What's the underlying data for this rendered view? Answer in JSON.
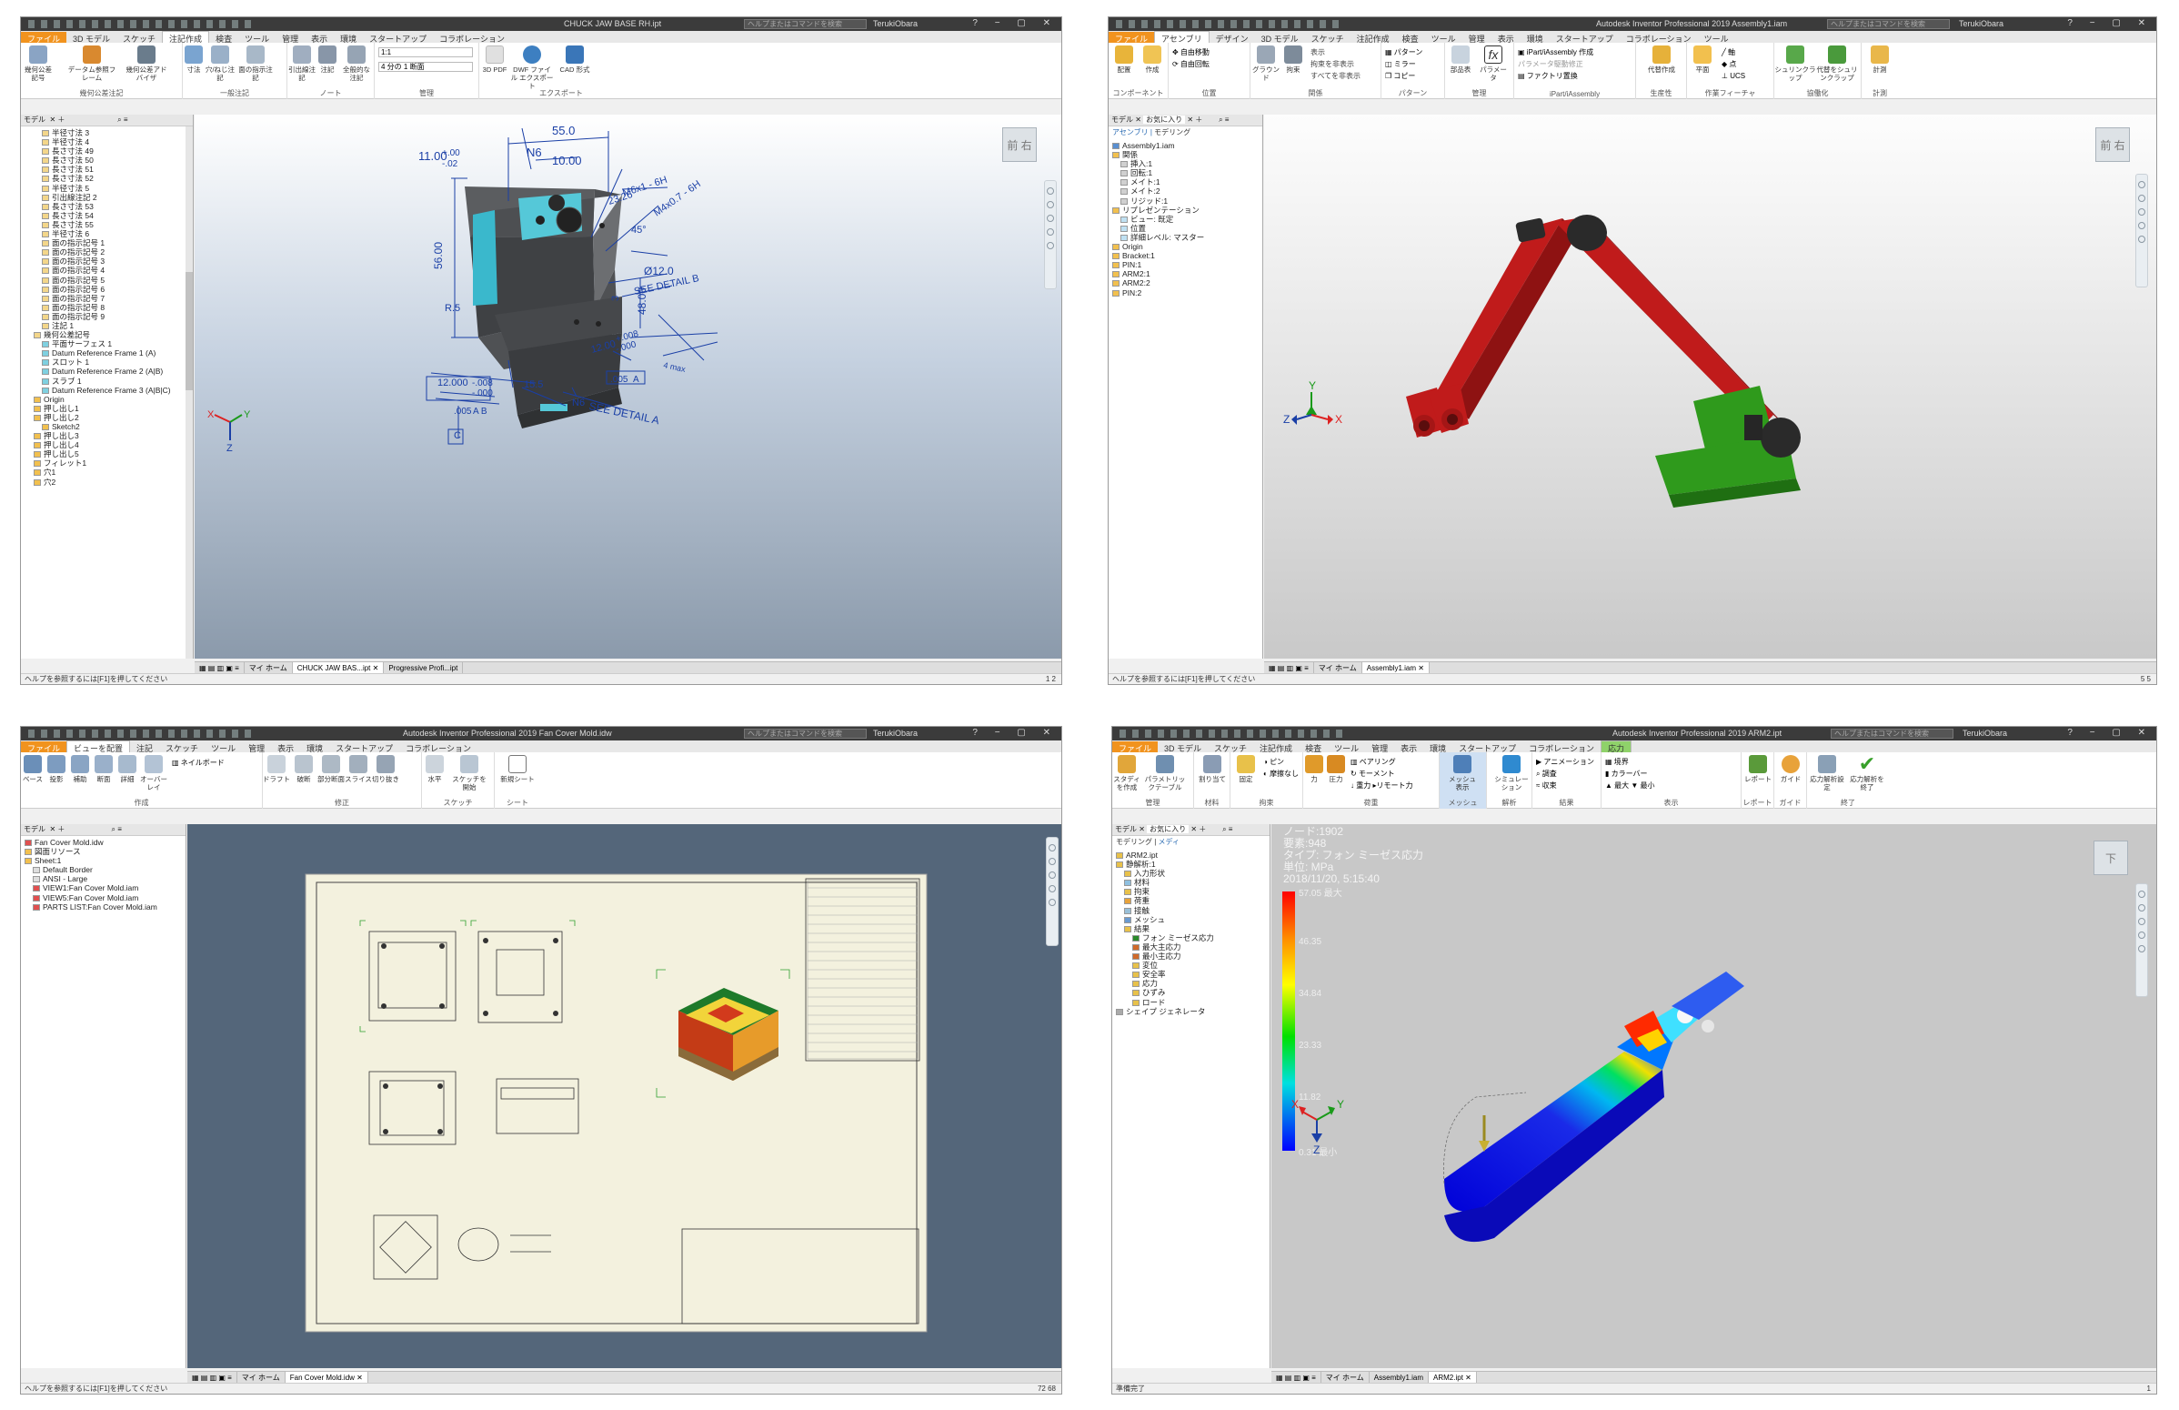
{
  "w1": {
    "title": "CHUCK JAW BASE RH.ipt",
    "search": "ヘルプまたはコマンドを検索",
    "user": "TerukiObara",
    "tabs": [
      "ファイル",
      "3D モデル",
      "スケッチ",
      "注記作成",
      "検査",
      "ツール",
      "管理",
      "表示",
      "環境",
      "スタートアップ",
      "コラボレーション"
    ],
    "groups": [
      "幾何公差注記",
      "一般注記",
      "ノート",
      "管理",
      "エクスポート"
    ],
    "buttons": [
      "幾何公差記号",
      "データム参照フレーム",
      "幾何公差アドバイザ",
      "寸法",
      "穴/ねじ注記",
      "面の指示注記",
      "引出線注記",
      "注記",
      "全般的な注記",
      "3D PDF",
      "DWF ファイル",
      "エクスポート",
      "CAD 形式"
    ],
    "scale": "1:1",
    "view_sel": "4 分の 1 断面",
    "panel_tabs": [
      "モデル"
    ],
    "tree": [
      "半径寸法 3",
      "半径寸法 4",
      "長さ寸法 49",
      "長さ寸法 50",
      "長さ寸法 51",
      "長さ寸法 52",
      "半径寸法 5",
      "引出線注記 2",
      "長さ寸法 53",
      "長さ寸法 54",
      "長さ寸法 55",
      "半径寸法 6",
      "面の指示記号 1",
      "面の指示記号 2",
      "面の指示記号 3",
      "面の指示記号 4",
      "面の指示記号 5",
      "面の指示記号 6",
      "面の指示記号 7",
      "面の指示記号 8",
      "面の指示記号 9",
      "注記 1",
      "幾何公差記号",
      "平面サーフェス 1",
      "Datum Reference Frame 1 (A)",
      "スロット 1",
      "Datum Reference Frame 2 (A|B)",
      "スラブ 1",
      "Datum Reference Frame 3 (A|B|C)",
      "Origin",
      "押し出し1",
      "押し出し2",
      "Sketch2",
      "押し出し3",
      "押し出し4",
      "押し出し5",
      "フィレット1",
      "穴1",
      "穴2"
    ],
    "doc_tabs": [
      "マイ ホーム",
      "CHUCK JAW BAS...ipt",
      "Progressive Profi...ipt"
    ],
    "status": "ヘルプを参照するには[F1]を押してください",
    "pages": "1    2",
    "viewcube": "前 右",
    "dims": [
      "55.0",
      "N6",
      "10.00",
      "11.00",
      "+.00",
      "-.02",
      "M6x1 - 6H",
      "23.26",
      "M4x0.7 - 6H",
      "45°",
      "Ø12.0",
      "SEE DETAIL B",
      "56.00",
      "R.5",
      "3",
      "48.00",
      "12.00",
      "+.008",
      "-.000",
      ".005",
      "A",
      "15.5",
      "12.000",
      "-.008",
      "-.000",
      ".005",
      "A B",
      "N6",
      "SEE DETAIL A",
      "C",
      "4 max"
    ],
    "axes": [
      "X",
      "Y",
      "Z"
    ]
  },
  "w2": {
    "title": "Autodesk Inventor Professional 2019    Assembly1.iam",
    "search": "ヘルプまたはコマンドを検索",
    "user": "TerukiObara",
    "tabs": [
      "ファイル",
      "アセンブリ",
      "デザイン",
      "3D モデル",
      "スケッチ",
      "注記作成",
      "検査",
      "ツール",
      "管理",
      "表示",
      "環境",
      "スタートアップ",
      "コラボレーション",
      "ツール"
    ],
    "groups": [
      "コンポーネント",
      "位置",
      "関係",
      "パターン",
      "管理",
      "iPart/iAssembly",
      "生産性",
      "作業フィーチャ",
      "協働化",
      "計測"
    ],
    "buttons": [
      "配置",
      "作成",
      "自由移動",
      "自由回転",
      "グラウンド",
      "拘束",
      "表示",
      "拘束を非表示",
      "すべてを非表示",
      "パターン",
      "ミラー",
      "コピー",
      "部品表",
      "パラメータ",
      "iPart/iAssembly 作成",
      "パラメータ駆動修正",
      "ファクトリ置換",
      "代替作成",
      "置換",
      "平面",
      "軸",
      "点",
      "UCS",
      "シュリンクラップ",
      "代替をシュリンクラップ",
      "計測"
    ],
    "panel_tabs": [
      "モデル",
      "お気に入り"
    ],
    "subtabs": [
      "アセンブリ",
      "モデリング"
    ],
    "tree": [
      "Assembly1.iam",
      "関係",
      "挿入:1",
      "回転:1",
      "メイト:1",
      "メイト:2",
      "リジッド:1",
      "リプレゼンテーション",
      "ビュー: 既定",
      "位置",
      "詳細レベル: マスター",
      "Origin",
      "Bracket:1",
      "PIN:1",
      "ARM2:1",
      "ARM2:2",
      "PIN:2"
    ],
    "doc_tabs": [
      "マイ ホーム",
      "Assembly1.iam"
    ],
    "status": "ヘルプを参照するには[F1]を押してください",
    "pages": "5    5",
    "viewcube": "前 右",
    "axes": [
      "Y",
      "Z",
      "X"
    ],
    "colors": {
      "arm": "#c11b1b",
      "base": "#2e9a1a",
      "knob": "#222222"
    }
  },
  "w3": {
    "title": "Autodesk Inventor Professional 2019    Fan Cover Mold.idw",
    "search": "ヘルプまたはコマンドを検索",
    "user": "TerukiObara",
    "tabs": [
      "ファイル",
      "ビューを配置",
      "注記",
      "スケッチ",
      "ツール",
      "管理",
      "表示",
      "環境",
      "スタートアップ",
      "コラボレーション"
    ],
    "groups": [
      "作成",
      "修正",
      "スケッチ",
      "シート"
    ],
    "buttons": [
      "ベース",
      "投影",
      "補助",
      "断面",
      "詳細",
      "オーバーレイ",
      "ネイルボード",
      "ドラフト",
      "破断",
      "部分断面",
      "スライス",
      "切り抜き",
      "水平",
      "スケッチを開始",
      "新規シート"
    ],
    "panel_tabs": [
      "モデル"
    ],
    "tree": [
      "Fan Cover Mold.idw",
      "図面リソース",
      "Sheet:1",
      "Default Border",
      "ANSI - Large",
      "VIEW1:Fan Cover Mold.iam",
      "VIEW5:Fan Cover Mold.iam",
      "PARTS LIST:Fan Cover Mold.iam"
    ],
    "doc_tabs": [
      "マイ ホーム",
      "Fan Cover Mold.idw"
    ],
    "status": "ヘルプを参照するには[F1]を押してください",
    "pages": "72   68"
  },
  "w4": {
    "title": "Autodesk Inventor Professional 2019    ARM2.ipt",
    "search": "ヘルプまたはコマンドを検索",
    "user": "TerukiObara",
    "tabs": [
      "ファイル",
      "3D モデル",
      "スケッチ",
      "注記作成",
      "検査",
      "ツール",
      "管理",
      "表示",
      "環境",
      "スタートアップ",
      "コラボレーション",
      "応力"
    ],
    "groups": [
      "管理",
      "材料",
      "拘束",
      "荷重",
      "接触",
      "準備",
      "メッシュ",
      "解析",
      "結果",
      "表示",
      "レポート",
      "ガイド",
      "終了"
    ],
    "buttons": [
      "スタディを作成",
      "パラメトリックテーブル",
      "割り当て",
      "固定",
      "ピン",
      "摩擦なし",
      "力",
      "圧力",
      "ベアリング",
      "モーメント",
      "重力",
      "リモート力",
      "メッシュ表示",
      "シミュレーション",
      "アニメーション",
      "調査",
      "収束",
      "境界",
      "カラーバー",
      "最大",
      "最小",
      "レポート",
      "ガイド",
      "応力解析設定",
      "応力解析を終了"
    ],
    "panel_tabs": [
      "モデル",
      "お気に入り"
    ],
    "subtabs": [
      "モデリング",
      "メディ"
    ],
    "tree": [
      "ARM2.ipt",
      "静解析:1",
      "入力形状",
      "材料",
      "拘束",
      "荷重",
      "接触",
      "メッシュ",
      "結果",
      "フォン ミーゼス応力",
      "最大主応力",
      "最小主応力",
      "変位",
      "安全率",
      "応力",
      "ひずみ",
      "ロード",
      "シェイプ ジェネレータ"
    ],
    "doc_tabs": [
      "マイ ホーム",
      "Assembly1.iam",
      "ARM2.ipt"
    ],
    "status": "準備完了",
    "pages": "1",
    "result": {
      "node": "ノード:1902",
      "elements": "要素:948",
      "type": "タイプ: フォン ミーゼス応力",
      "unit": "単位: MPa",
      "date": "2018/11/20, 5:15:40"
    },
    "legend": {
      "max": "57.05 最大",
      "min": "0.31 最小",
      "ticks": [
        "46.35",
        "34.84",
        "23.33",
        "11.82"
      ]
    },
    "viewcube": "下",
    "axes": [
      "X",
      "Y",
      "Z"
    ]
  }
}
